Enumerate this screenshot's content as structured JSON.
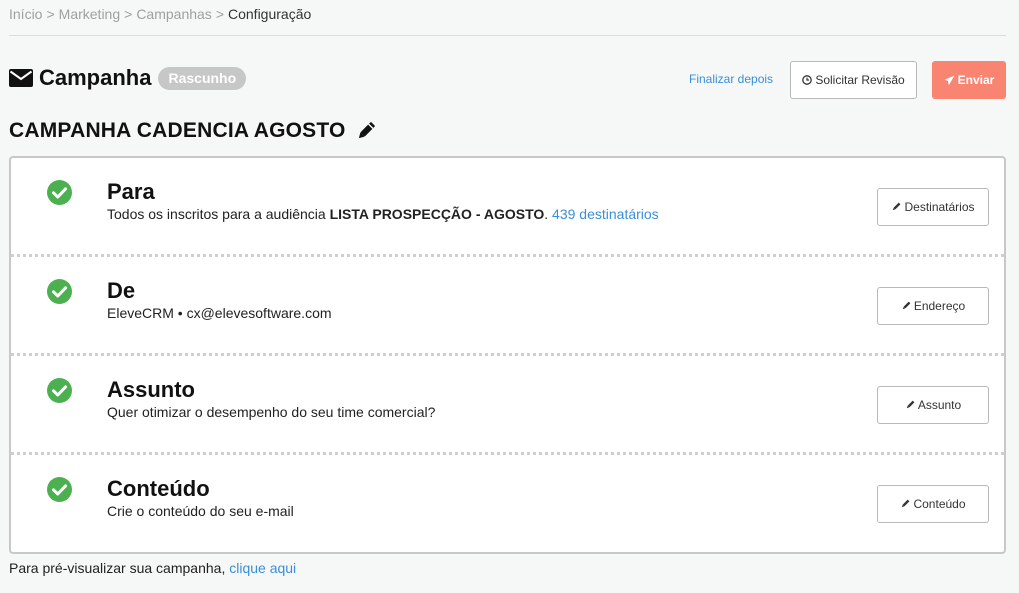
{
  "breadcrumb": {
    "items": [
      "Início",
      "Marketing",
      "Campanhas"
    ],
    "separator": ">",
    "current": "Configuração"
  },
  "header": {
    "title": "Campanha",
    "status_badge": "Rascunho",
    "finalize_link": "Finalizar depois",
    "review_button": "Solicitar Revisão",
    "send_button": "Enviar"
  },
  "campaign": {
    "name": "CAMPANHA CADENCIA AGOSTO"
  },
  "sections": {
    "para": {
      "title": "Para",
      "desc_prefix": "Todos os inscritos para a audiência ",
      "audience": "LISTA PROSPECÇÃO - AGOSTO",
      "desc_sep": ". ",
      "recipients_link": "439 destinatários",
      "button": "Destinatários"
    },
    "de": {
      "title": "De",
      "desc": "EleveCRM • cx@elevesoftware.com",
      "button": "Endereço"
    },
    "assunto": {
      "title": "Assunto",
      "desc": "Quer otimizar o desempenho do seu time comercial?",
      "button": "Assunto"
    },
    "conteudo": {
      "title": "Conteúdo",
      "desc": "Crie o conteúdo do seu e-mail",
      "button": "Conteúdo"
    }
  },
  "footer": {
    "text": "Para pré-visualizar sua campanha, ",
    "link": "clique aqui"
  },
  "colors": {
    "accent_link": "#3a8fd8",
    "send_button": "#f98472",
    "check_green": "#4caf50",
    "badge_gray": "#c7c7c7"
  },
  "icons": {
    "header": "envelope-icon",
    "review": "clock-icon",
    "send": "paper-plane-icon",
    "edit": "pencil-icon",
    "status": "check-circle-icon"
  }
}
